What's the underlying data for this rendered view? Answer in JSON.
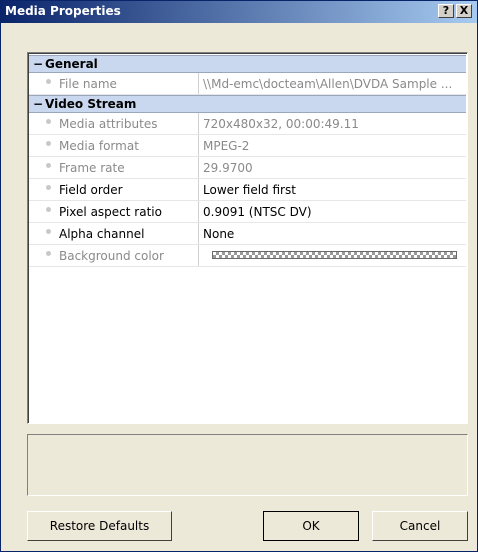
{
  "window": {
    "title": "Media Properties",
    "help_label": "?",
    "close_label": "X"
  },
  "grid": {
    "categories": [
      {
        "label": "General",
        "toggle": "−"
      },
      {
        "label": "Video Stream",
        "toggle": "−"
      }
    ],
    "general_rows": [
      {
        "name": "File name",
        "value": "\\\\Md-emc\\docteam\\Allen\\DVDA Sample ...",
        "readonly": true
      }
    ],
    "video_rows": [
      {
        "name": "Media attributes",
        "value": "720x480x32, 00:00:49.11",
        "readonly": true
      },
      {
        "name": "Media format",
        "value": "MPEG-2",
        "readonly": true
      },
      {
        "name": "Frame rate",
        "value": "29.9700",
        "readonly": true
      },
      {
        "name": "Field order",
        "value": "Lower field first",
        "readonly": false
      },
      {
        "name": "Pixel aspect ratio",
        "value": "0.9091 (NTSC DV)",
        "readonly": false
      },
      {
        "name": "Alpha channel",
        "value": "None",
        "readonly": false
      },
      {
        "name": "Background color",
        "value": "",
        "readonly": true
      }
    ]
  },
  "buttons": {
    "restore": "Restore Defaults",
    "ok": "OK",
    "cancel": "Cancel"
  }
}
